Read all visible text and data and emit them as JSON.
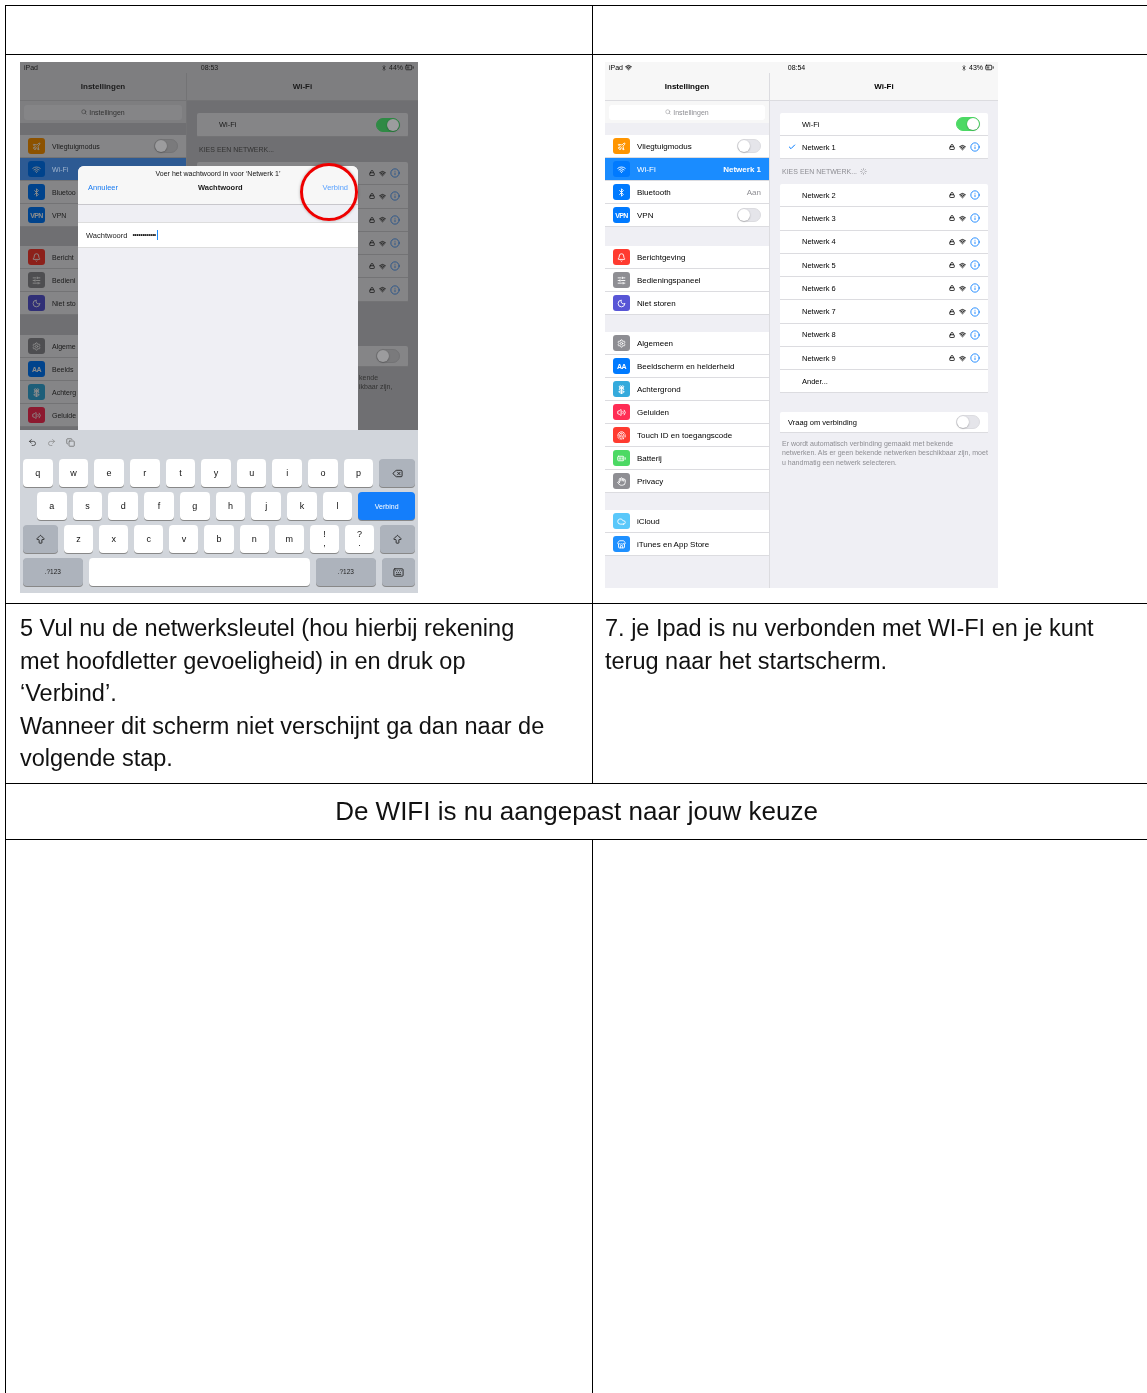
{
  "document_table": {
    "screenshots": [
      {
        "kind": "password_dialog",
        "status_bar": {
          "carrier": "iPad",
          "carrier_wifi": false,
          "time": "08:53",
          "battery": "44%"
        },
        "sidebar": {
          "title": "Instellingen",
          "search_placeholder": "Instellingen",
          "groups": [
            [
              {
                "label": "Vliegtuigmodus",
                "toggle": false,
                "selected": false
              },
              {
                "label": "Wi-Fi",
                "selected": true
              },
              {
                "label": "Bluetoo",
                "selected": false
              },
              {
                "label": "VPN",
                "badge": "VPN",
                "selected": false
              }
            ],
            [
              {
                "label": "Bericht",
                "selected": false
              },
              {
                "label": "Bedieni",
                "selected": false
              },
              {
                "label": "Niet sto",
                "selected": false
              }
            ],
            [
              {
                "label": "Algeme",
                "selected": false
              },
              {
                "label": "Beelds",
                "badge": "AA",
                "selected": false
              },
              {
                "label": "Achterg",
                "selected": false
              },
              {
                "label": "Geluide",
                "selected": false
              }
            ]
          ]
        },
        "detail": {
          "title": "Wi-Fi",
          "wifi_label": "Wi-Fi",
          "wifi_on": true,
          "section_header": "KIES EEN NETWERK...",
          "networks": [
            {
              "locked": true
            },
            {
              "locked": true
            },
            {
              "locked": true
            },
            {
              "locked": true
            },
            {
              "locked": true
            },
            {
              "locked": true
            }
          ],
          "ask_to_join_on": false,
          "footer_fragments": [
            "kende",
            "ikbaar zijn,"
          ]
        },
        "dialog": {
          "prompt": "Voer het wachtwoord in voor ‘Netwerk 1’",
          "cancel": "Annuleer",
          "title": "Wachtwoord",
          "confirm": "Verbind",
          "confirm_circled": true,
          "field_label": "Wachtwoord",
          "field_value": "••••••••••••"
        },
        "keyboard": {
          "rows": [
            [
              {
                "kind": "char",
                "label": "q"
              },
              {
                "kind": "char",
                "label": "w"
              },
              {
                "kind": "char",
                "label": "e"
              },
              {
                "kind": "char",
                "label": "r"
              },
              {
                "kind": "char",
                "label": "t"
              },
              {
                "kind": "char",
                "label": "y"
              },
              {
                "kind": "char",
                "label": "u"
              },
              {
                "kind": "char",
                "label": "i"
              },
              {
                "kind": "char",
                "label": "o"
              },
              {
                "kind": "char",
                "label": "p"
              },
              {
                "kind": "backspace"
              }
            ],
            [
              {
                "kind": "char",
                "label": "a"
              },
              {
                "kind": "char",
                "label": "s"
              },
              {
                "kind": "char",
                "label": "d"
              },
              {
                "kind": "char",
                "label": "f"
              },
              {
                "kind": "char",
                "label": "g"
              },
              {
                "kind": "char",
                "label": "h"
              },
              {
                "kind": "char",
                "label": "j"
              },
              {
                "kind": "char",
                "label": "k"
              },
              {
                "kind": "char",
                "label": "l"
              },
              {
                "kind": "action",
                "label": "Verbind"
              }
            ],
            [
              {
                "kind": "shift"
              },
              {
                "kind": "char",
                "label": "z"
              },
              {
                "kind": "char",
                "label": "x"
              },
              {
                "kind": "char",
                "label": "c"
              },
              {
                "kind": "char",
                "label": "v"
              },
              {
                "kind": "char",
                "label": "b"
              },
              {
                "kind": "char",
                "label": "n"
              },
              {
                "kind": "char",
                "label": "m"
              },
              {
                "kind": "char",
                "label": "!",
                "sub": ","
              },
              {
                "kind": "char",
                "label": "?",
                "sub": "."
              },
              {
                "kind": "shift"
              }
            ],
            [
              {
                "kind": "mode",
                "label": ".?123"
              },
              {
                "kind": "space"
              },
              {
                "kind": "mode",
                "label": ".?123"
              },
              {
                "kind": "dismiss"
              }
            ]
          ]
        }
      },
      {
        "kind": "wifi_list",
        "status_bar": {
          "carrier": "iPad",
          "carrier_wifi": true,
          "time": "08:54",
          "battery": "43%"
        },
        "sidebar": {
          "title": "Instellingen",
          "search_placeholder": "Instellingen",
          "groups": [
            [
              {
                "label": "Vliegtuigmodus",
                "toggle": false,
                "selected": false
              },
              {
                "label": "Wi-Fi",
                "value": "Netwerk 1",
                "selected": true
              },
              {
                "label": "Bluetooth",
                "value": "Aan",
                "selected": false
              },
              {
                "label": "VPN",
                "badge": "VPN",
                "toggle": false,
                "selected": false
              }
            ],
            [
              {
                "label": "Berichtgeving",
                "selected": false
              },
              {
                "label": "Bedieningspaneel",
                "selected": false
              },
              {
                "label": "Niet storen",
                "selected": false
              }
            ],
            [
              {
                "label": "Algemeen",
                "selected": false
              },
              {
                "label": "Beeldscherm en helderheid",
                "badge": "AA",
                "selected": false
              },
              {
                "label": "Achtergrond",
                "selected": false
              },
              {
                "label": "Geluiden",
                "selected": false
              },
              {
                "label": "Touch ID en toegangscode",
                "selected": false
              },
              {
                "label": "Batterij",
                "selected": false
              },
              {
                "label": "Privacy",
                "selected": false
              }
            ],
            [
              {
                "label": "iCloud",
                "selected": false
              },
              {
                "label": "iTunes en App Store",
                "selected": false
              }
            ]
          ]
        },
        "detail": {
          "title": "Wi-Fi",
          "wifi_label": "Wi-Fi",
          "wifi_on": true,
          "connected": {
            "name": "Netwerk 1",
            "checked": true,
            "locked": true
          },
          "section_header": "KIES EEN NETWERK...",
          "scanning": true,
          "networks": [
            {
              "name": "Netwerk 2",
              "locked": true
            },
            {
              "name": "Netwerk 3",
              "locked": true
            },
            {
              "name": "Netwerk 4",
              "locked": true
            },
            {
              "name": "Netwerk 5",
              "locked": true
            },
            {
              "name": "Netwerk 6",
              "locked": true
            },
            {
              "name": "Netwerk 7",
              "locked": true
            },
            {
              "name": "Netwerk 8",
              "locked": true
            },
            {
              "name": "Netwerk 9",
              "locked": true
            }
          ],
          "other": "Ander...",
          "ask_label": "Vraag om verbinding",
          "ask_to_join_on": false,
          "footnote": "Er wordt automatisch verbinding gemaakt met bekende netwerken. Als er geen bekende netwerken beschikbaar zijn, moet u handmatig een netwerk selecteren."
        }
      }
    ],
    "captions": [
      {
        "paragraphs": [
          "5 Vul nu de netwerksleutel (hou hierbij rekening met hoofdletter gevoeligheid) in en druk op ‘Verbind’.",
          "Wanneer dit scherm niet verschijnt ga dan naar de volgende stap."
        ]
      },
      {
        "paragraphs": [
          "7. je Ipad is nu verbonden met WI-FI en je kunt terug naar het startscherm."
        ]
      }
    ],
    "summary": "De WIFI is nu aangepast naar jouw keuze"
  }
}
